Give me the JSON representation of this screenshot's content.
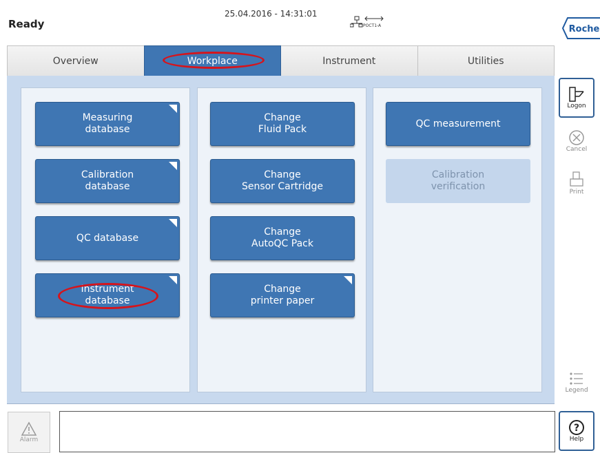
{
  "header": {
    "status": "Ready",
    "datetime": "25.04.2016 - 14:31:01",
    "network_label": "POCT1-A",
    "logo_text": "Roche"
  },
  "tabs": [
    {
      "label": "Overview",
      "active": false
    },
    {
      "label": "Workplace",
      "active": true
    },
    {
      "label": "Instrument",
      "active": false
    },
    {
      "label": "Utilities",
      "active": false
    }
  ],
  "workplace": {
    "col1": [
      {
        "label": "Measuring\ndatabase",
        "corner": true
      },
      {
        "label": "Calibration\ndatabase",
        "corner": true
      },
      {
        "label": "QC database",
        "corner": true
      },
      {
        "label": "Instrument\ndatabase",
        "corner": true
      }
    ],
    "col2": [
      {
        "label": "Change\nFluid Pack",
        "corner": false
      },
      {
        "label": "Change\nSensor Cartridge",
        "corner": false
      },
      {
        "label": "Change\nAutoQC Pack",
        "corner": false
      },
      {
        "label": "Change\nprinter paper",
        "corner": true
      }
    ],
    "col3": [
      {
        "label": "QC measurement",
        "corner": false,
        "enabled": true
      },
      {
        "label": "Calibration\nverification",
        "corner": false,
        "enabled": false
      }
    ]
  },
  "sidebar": {
    "logon": "Logon",
    "cancel": "Cancel",
    "print": "Print",
    "legend": "Legend",
    "help": "Help"
  },
  "bottom": {
    "alarm": "Alarm",
    "message": ""
  },
  "colors": {
    "accent": "#3f76b3",
    "highlight": "#d6141b",
    "panel": "#c8d9ee"
  }
}
